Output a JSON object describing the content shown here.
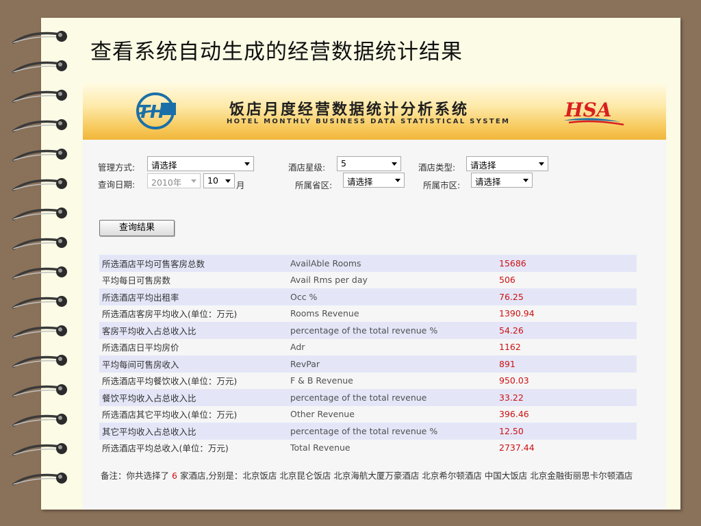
{
  "slide": {
    "title": "查看系统自动生成的经营数据统计结果"
  },
  "banner": {
    "title_cn": "饭店月度经营数据统计分析系统",
    "title_en": "HOTEL MONTHLY BUSINESS DATA STATISTICAL SYSTEM",
    "brand": "HSA",
    "logo_text": "TH"
  },
  "filters": {
    "mgmt_label": "管理方式:",
    "mgmt_value": "请选择",
    "star_label": "酒店星级:",
    "star_value": "5",
    "type_label": "酒店类型:",
    "type_value": "请选择",
    "date_label": "查询日期:",
    "year_value": "2010年",
    "month_value": "10",
    "month_unit": "月",
    "province_label": "所属省区:",
    "province_value": "请选择",
    "city_label": "所属市区:",
    "city_value": "请选择"
  },
  "query_button": "查询结果",
  "stats": [
    {
      "cn": "所选酒店平均可售客房总数",
      "en": "AvailAble Rooms",
      "value": "15686"
    },
    {
      "cn": "平均每日可售房数",
      "en": "Avail Rms per day",
      "value": "506"
    },
    {
      "cn": "所选酒店平均出租率",
      "en": "Occ %",
      "value": "76.25"
    },
    {
      "cn": "所选酒店客房平均收入(单位：万元)",
      "en": "Rooms Revenue",
      "value": "1390.94"
    },
    {
      "cn": "客房平均收入占总收入比",
      "en": "percentage of the total revenue %",
      "value": "54.26"
    },
    {
      "cn": "所选酒店日平均房价",
      "en": "Adr",
      "value": "1162"
    },
    {
      "cn": "平均每间可售房收入",
      "en": "RevPar",
      "value": "891"
    },
    {
      "cn": "所选酒店平均餐饮收入(单位：万元)",
      "en": "F & B Revenue",
      "value": "950.03"
    },
    {
      "cn": "餐饮平均收入占总收入比",
      "en": "percentage of the total revenue",
      "value": "33.22"
    },
    {
      "cn": "所选酒店其它平均收入(单位：万元)",
      "en": "Other Revenue",
      "value": "396.46"
    },
    {
      "cn": "其它平均收入占总收入比",
      "en": "percentage of the total revenue %",
      "value": "12.50"
    },
    {
      "cn": "所选酒店平均总收入(单位：万元)",
      "en": "Total Revenue",
      "value": "2737.44"
    }
  ],
  "remark": {
    "prefix": "备注：你共选择了",
    "count": "6",
    "suffix": "家酒店,分别是：北京饭店 北京昆仑饭店 北京海航大厦万豪酒店 北京希尔顿酒店 中国大饭店 北京金融街丽思卡尔顿酒店"
  },
  "colors": {
    "background": "#8a7159",
    "paper": "#fbfbe6",
    "banner_gold": "#f1b63a",
    "row_highlight": "#e4e6f8",
    "value_red": "#cc1010",
    "logo_blue": "#1b6fa8"
  }
}
